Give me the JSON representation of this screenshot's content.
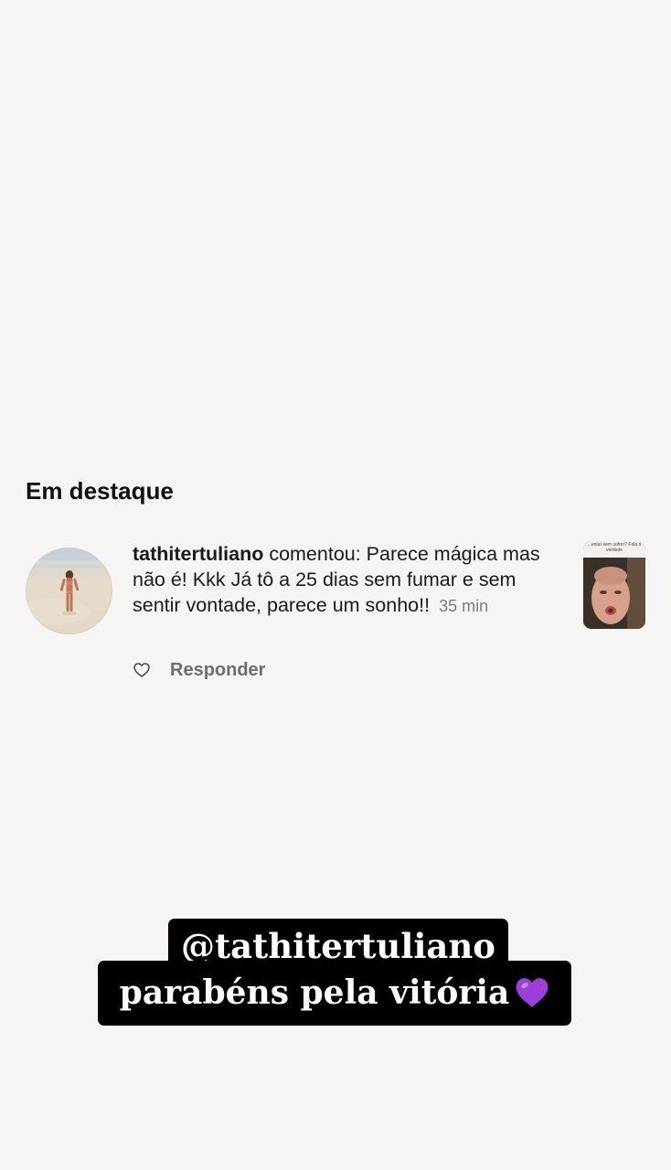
{
  "section": {
    "title": "Em destaque"
  },
  "comment": {
    "username": "tathitertuliano",
    "text": " comentou: Parece mágica mas não é! Kkk Já tô a 25 dias sem fumar e sem sentir vontade, parece um sonho!!",
    "time": "35 min",
    "like_icon": "heart-outline-icon",
    "reply_label": "Responder"
  },
  "post_thumbnail": {
    "caption": "...entar sem sofrer? Fala a verdade"
  },
  "sticker": {
    "mention": "@tathitertuliano",
    "message": "parabéns pela vitória",
    "emoji": "purple-heart-icon",
    "emoji_color": "#9b3fd8"
  },
  "colors": {
    "background": "#f6f5f4",
    "sticker_bg": "#000000",
    "secondary_text": "#7b7b7b"
  }
}
